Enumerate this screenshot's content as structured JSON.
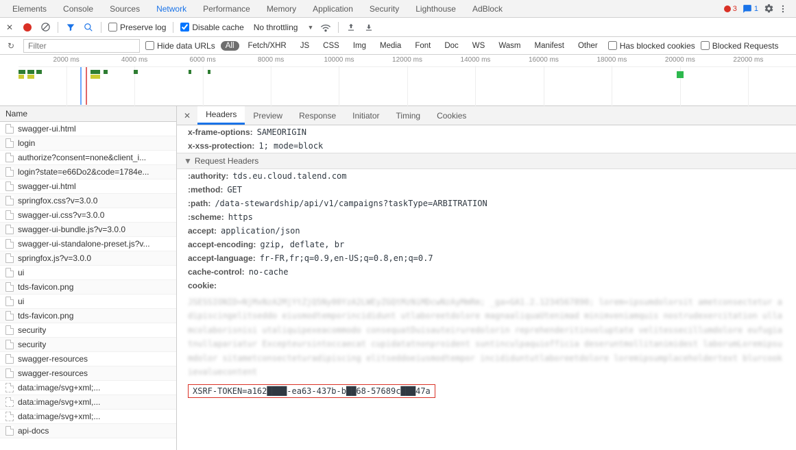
{
  "main_tabs": {
    "items": [
      "Elements",
      "Console",
      "Sources",
      "Network",
      "Performance",
      "Memory",
      "Application",
      "Security",
      "Lighthouse",
      "AdBlock"
    ],
    "active": "Network"
  },
  "counters": {
    "errors": "3",
    "messages": "1"
  },
  "toolbar": {
    "preserve_log": "Preserve log",
    "disable_cache": "Disable cache",
    "throttling": "No throttling"
  },
  "filter_row": {
    "placeholder": "Filter",
    "hide_data_urls": "Hide data URLs",
    "types": [
      "All",
      "Fetch/XHR",
      "JS",
      "CSS",
      "Img",
      "Media",
      "Font",
      "Doc",
      "WS",
      "Wasm",
      "Manifest",
      "Other"
    ],
    "active_type": "All",
    "has_blocked": "Has blocked cookies",
    "blocked_req": "Blocked Requests"
  },
  "timeline": {
    "ticks": [
      "2000 ms",
      "4000 ms",
      "6000 ms",
      "8000 ms",
      "10000 ms",
      "12000 ms",
      "14000 ms",
      "16000 ms",
      "18000 ms",
      "20000 ms",
      "22000 ms"
    ]
  },
  "reqlist": {
    "header": "Name",
    "rows": [
      {
        "name": "swagger-ui.html",
        "dash": false
      },
      {
        "name": "login",
        "dash": false
      },
      {
        "name": "authorize?consent=none&client_i...",
        "dash": false
      },
      {
        "name": "login?state=e66Do2&code=1784e...",
        "dash": false
      },
      {
        "name": "swagger-ui.html",
        "dash": false
      },
      {
        "name": "springfox.css?v=3.0.0",
        "dash": false
      },
      {
        "name": "swagger-ui.css?v=3.0.0",
        "dash": false
      },
      {
        "name": "swagger-ui-bundle.js?v=3.0.0",
        "dash": false
      },
      {
        "name": "swagger-ui-standalone-preset.js?v...",
        "dash": false
      },
      {
        "name": "springfox.js?v=3.0.0",
        "dash": false
      },
      {
        "name": "ui",
        "dash": false
      },
      {
        "name": "tds-favicon.png",
        "dash": false
      },
      {
        "name": "ui",
        "dash": false
      },
      {
        "name": "tds-favicon.png",
        "dash": false
      },
      {
        "name": "security",
        "dash": false
      },
      {
        "name": "security",
        "dash": false
      },
      {
        "name": "swagger-resources",
        "dash": false
      },
      {
        "name": "swagger-resources",
        "dash": false
      },
      {
        "name": "data:image/svg+xml;...",
        "dash": true
      },
      {
        "name": "data:image/svg+xml,...",
        "dash": true
      },
      {
        "name": "data:image/svg+xml;...",
        "dash": true
      },
      {
        "name": "api-docs",
        "dash": false
      }
    ]
  },
  "detail_tabs": [
    "Headers",
    "Preview",
    "Response",
    "Initiator",
    "Timing",
    "Cookies"
  ],
  "detail_active": "Headers",
  "response_headers_tail": [
    {
      "k": "x-frame-options:",
      "v": "SAMEORIGIN"
    },
    {
      "k": "x-xss-protection:",
      "v": "1; mode=block"
    }
  ],
  "request_section": "Request Headers",
  "request_headers": [
    {
      "k": ":authority:",
      "v": "tds.eu.cloud.talend.com"
    },
    {
      "k": ":method:",
      "v": "GET"
    },
    {
      "k": ":path:",
      "v": "/data-stewardship/api/v1/campaigns?taskType=ARBITRATION"
    },
    {
      "k": ":scheme:",
      "v": "https"
    },
    {
      "k": "accept:",
      "v": "application/json"
    },
    {
      "k": "accept-encoding:",
      "v": "gzip, deflate, br"
    },
    {
      "k": "accept-language:",
      "v": "fr-FR,fr;q=0.9,en-US;q=0.8,en;q=0.7"
    },
    {
      "k": "cache-control:",
      "v": "no-cache"
    },
    {
      "k": "cookie:",
      "v": ""
    }
  ],
  "xsrf_token": "XSRF-TOKEN=a162████-ea63-437b-b██68-57689c███47a"
}
